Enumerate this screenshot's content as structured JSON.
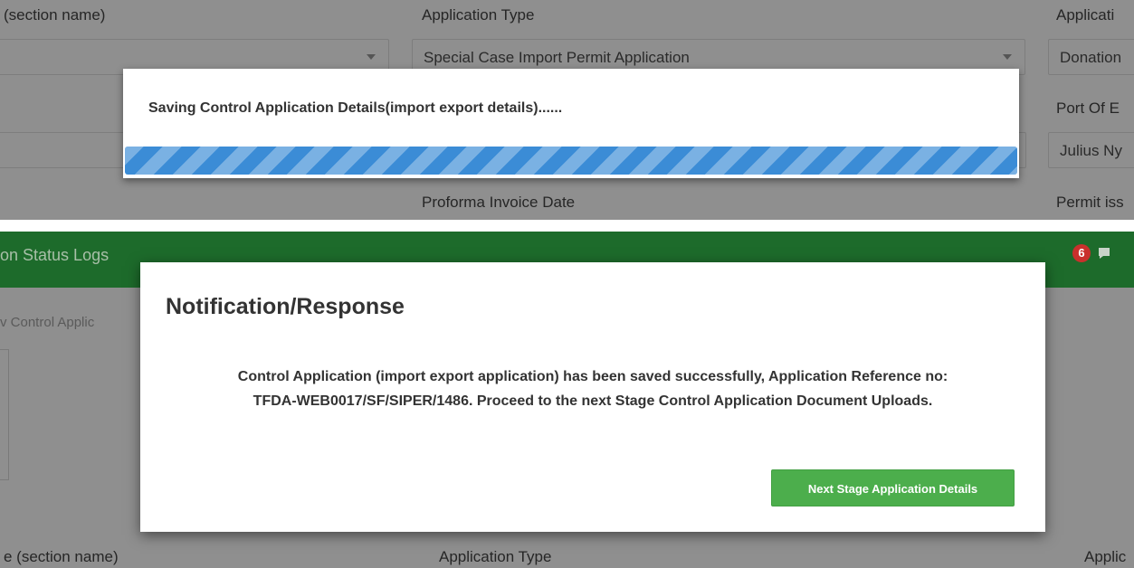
{
  "top_form": {
    "section_name_label": "(section name)",
    "application_type_label": "Application Type",
    "application_type_value": "Special Case Import Permit Application",
    "application_col3_label": "Applicati",
    "application_col3_value": "Donation",
    "port_label": "Port Of E",
    "port_value": "Julius Ny",
    "proforma_invoice_date_label": "Proforma Invoice Date",
    "permit_issue_label": "Permit iss"
  },
  "saving_dialog": {
    "message": "Saving Control Application Details(import export details)......",
    "progress": 1.0
  },
  "status_panel": {
    "title": "on Status Logs",
    "badge_count": "6",
    "sub_label": "v Control Applic"
  },
  "notification_dialog": {
    "title": "Notification/Response",
    "message_line1": "Control Application (import export application) has been saved successfully, Application Reference no:",
    "message_line2": "TFDA-WEB0017/SF/SIPER/1486. Proceed to the next Stage Control Application Document Uploads.",
    "next_button_label": "Next Stage Application Details"
  },
  "bottom_form": {
    "section_name_label": "e (section name)",
    "application_type_label": "Application Type",
    "application_col3_label": "Applic"
  },
  "colors": {
    "overlay_gray": "#8f8f8f",
    "header_green": "#1d6b2b",
    "progress_blue": "#3b8cd6",
    "button_green": "#4cae4c",
    "badge_red": "#c9302c"
  }
}
